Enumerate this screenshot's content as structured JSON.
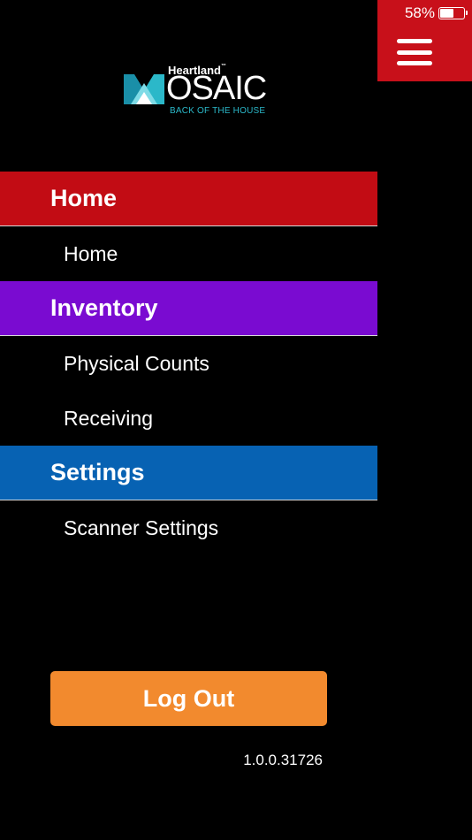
{
  "status_bar": {
    "battery_text": "58%",
    "battery_level": 0.58
  },
  "logo": {
    "brand": "Heartland",
    "trademark": "™",
    "wordmark": "OSAIC",
    "tagline": "BACK OF THE HOUSE"
  },
  "menu": {
    "sections": [
      {
        "title": "Home",
        "items": [
          "Home"
        ]
      },
      {
        "title": "Inventory",
        "items": [
          "Physical Counts",
          "Receiving"
        ]
      },
      {
        "title": "Settings",
        "items": [
          "Scanner Settings"
        ]
      }
    ]
  },
  "logout_label": "Log Out",
  "version": "1.0.0.31726",
  "colors": {
    "home": "#c20c14",
    "inventory": "#7a0bd1",
    "settings": "#0762b3",
    "logout": "#f28a2e",
    "header": "#c8101a"
  }
}
